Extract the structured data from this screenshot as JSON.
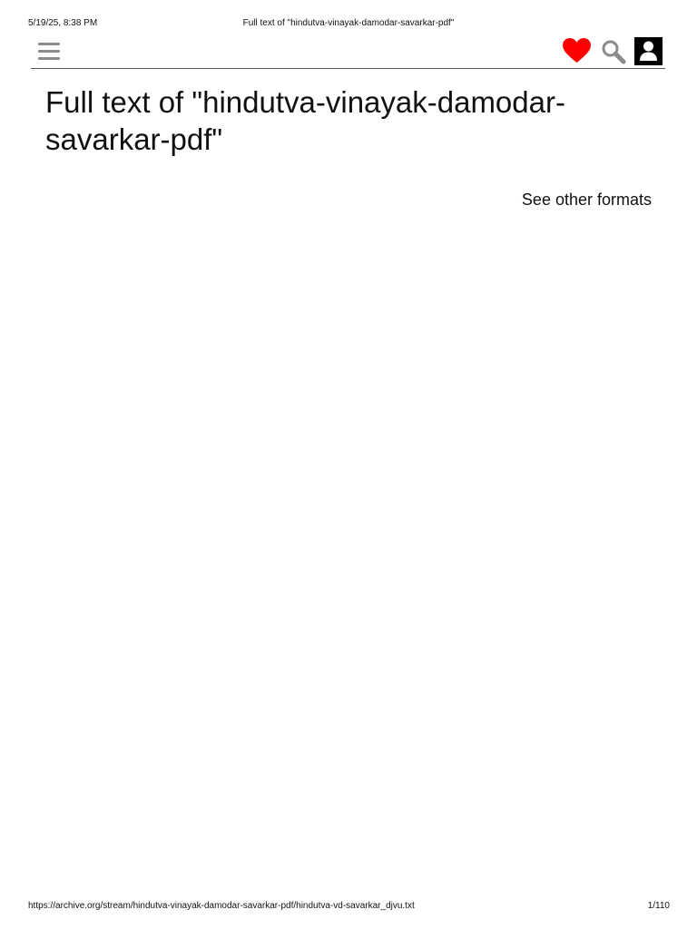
{
  "print_header": {
    "datetime": "5/19/25, 8:38 PM",
    "document_title": "Full text of \"hindutva-vinayak-damodar-savarkar-pdf\""
  },
  "topbar": {
    "menu_icon": "hamburger-menu-icon",
    "donate_icon": "heart-icon",
    "search_icon": "search-icon",
    "account_icon": "user-account-icon",
    "colors": {
      "menu": "#8c8c8c",
      "heart": "#ff0000",
      "search": "#8c8c8c",
      "account_bg": "#000000"
    }
  },
  "main": {
    "title": "Full text of \"hindutva-vinayak-damodar-savarkar-pdf\"",
    "other_formats_link": "See other formats"
  },
  "print_footer": {
    "url": "https://archive.org/stream/hindutva-vinayak-damodar-savarkar-pdf/hindutva-vd-savarkar_djvu.txt",
    "page_counter": "1/110"
  }
}
